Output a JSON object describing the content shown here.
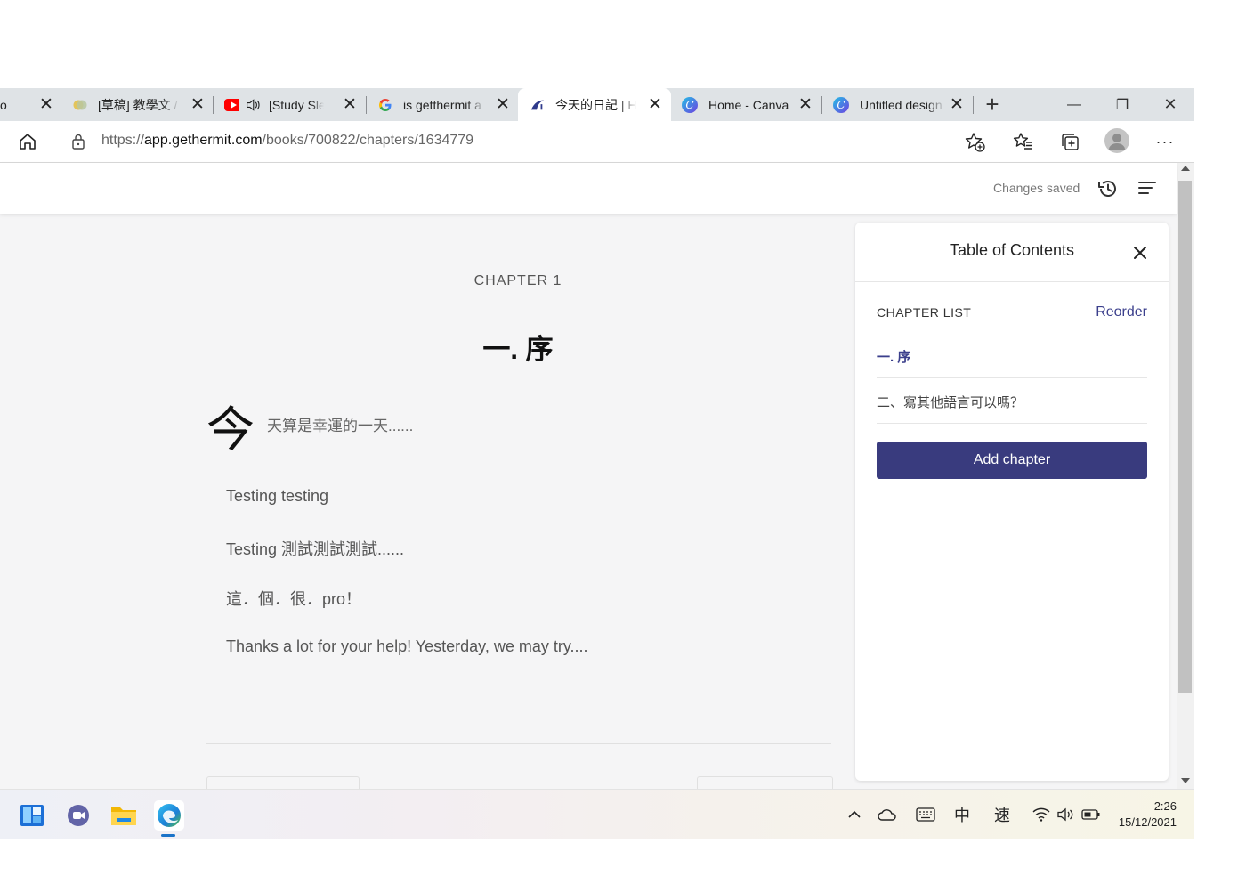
{
  "browser": {
    "tabs": [
      {
        "title": "o",
        "active": false
      },
      {
        "title": "[草稿] 教學文 /",
        "active": false
      },
      {
        "title": "[Study Sle",
        "active": false
      },
      {
        "title": "is getthermit a",
        "active": false
      },
      {
        "title": "今天的日記 | H",
        "active": true
      },
      {
        "title": "Home - Canva",
        "active": false
      },
      {
        "title": "Untitled design",
        "active": false
      }
    ],
    "new_tab_symbol": "+",
    "window_controls": {
      "minimize": "—",
      "restore": "❐",
      "close": "✕"
    },
    "url": {
      "scheme": "https://",
      "host": "app.gethermit.com",
      "path": "/books/700822/chapters/1634779"
    },
    "toolbar_icons": [
      "home-icon",
      "lock-icon",
      "add-favorite-icon",
      "favorites-icon",
      "collections-icon",
      "profile-avatar",
      "more-icon"
    ],
    "more_label": "···"
  },
  "app": {
    "save_status": "Changes saved",
    "header_icons": [
      "history-icon",
      "menu-icon"
    ]
  },
  "chapter": {
    "label": "CHAPTER 1",
    "title": "一. 序",
    "dropcap": "今",
    "lead": "天算是幸運的一天......",
    "paragraphs": [
      "Testing testing",
      "Testing 測試測試測試......",
      "這．個．很．pro！",
      "Thanks a lot for your help! Yesterday, we may try...."
    ]
  },
  "toc": {
    "title": "Table of Contents",
    "list_label": "CHAPTER LIST",
    "reorder_label": "Reorder",
    "chapters": [
      {
        "title": "一. 序",
        "current": true
      },
      {
        "title": "二、寫其他語言可以嗎？",
        "current": false
      }
    ],
    "add_label": "Add chapter"
  },
  "taskbar": {
    "apps": [
      "widgets-icon",
      "chat-icon",
      "file-explorer-icon",
      "edge-icon"
    ],
    "tray": {
      "ime_lang": "中",
      "ime_mode": "速"
    },
    "time": "2:26",
    "date": "15/12/2021"
  },
  "colors": {
    "accent": "#393b7e",
    "link": "#3b3f8c",
    "tabstrip": "#dfe3e6",
    "page_bg": "#f5f5f6"
  }
}
